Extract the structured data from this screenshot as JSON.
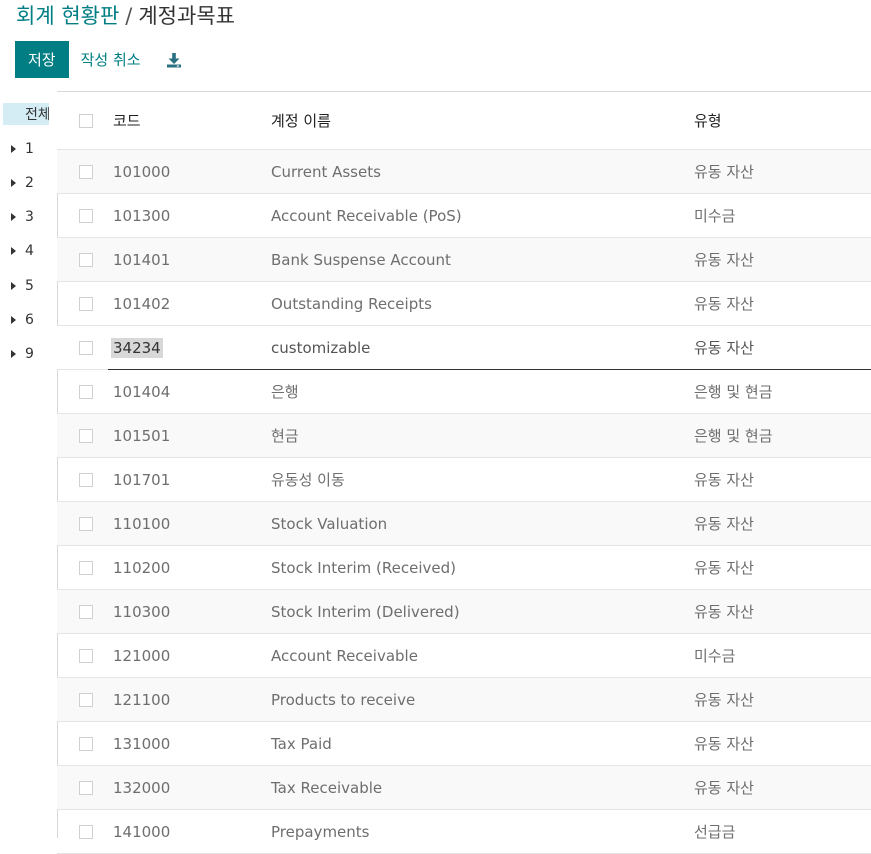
{
  "breadcrumb": {
    "parent": "회계 현황판",
    "separator": "/",
    "current": "계정과목표"
  },
  "toolbar": {
    "save_label": "저장",
    "discard_label": "작성 취소",
    "download_icon": "download-icon"
  },
  "sidebar": {
    "all_label": "전체",
    "groups": [
      "1",
      "2",
      "3",
      "4",
      "5",
      "6",
      "9"
    ]
  },
  "table": {
    "columns": {
      "code": "코드",
      "name": "계정 이름",
      "type": "유형"
    },
    "rows": [
      {
        "code": "101000",
        "name": "Current Assets",
        "type": "유동 자산"
      },
      {
        "code": "101300",
        "name": "Account Receivable (PoS)",
        "type": "미수금"
      },
      {
        "code": "101401",
        "name": "Bank Suspense Account",
        "type": "유동 자산"
      },
      {
        "code": "101402",
        "name": "Outstanding Receipts",
        "type": "유동 자산"
      },
      {
        "code": "34234",
        "name": "customizable",
        "type": "유동 자산",
        "editing": true
      },
      {
        "code": "101404",
        "name": "은행",
        "type": "은행 및 현금"
      },
      {
        "code": "101501",
        "name": "현금",
        "type": "은행 및 현금"
      },
      {
        "code": "101701",
        "name": "유동성 이동",
        "type": "유동 자산"
      },
      {
        "code": "110100",
        "name": "Stock Valuation",
        "type": "유동 자산"
      },
      {
        "code": "110200",
        "name": "Stock Interim (Received)",
        "type": "유동 자산"
      },
      {
        "code": "110300",
        "name": "Stock Interim (Delivered)",
        "type": "유동 자산"
      },
      {
        "code": "121000",
        "name": "Account Receivable",
        "type": "미수금"
      },
      {
        "code": "121100",
        "name": "Products to receive",
        "type": "유동 자산"
      },
      {
        "code": "131000",
        "name": "Tax Paid",
        "type": "유동 자산"
      },
      {
        "code": "132000",
        "name": "Tax Receivable",
        "type": "유동 자산"
      },
      {
        "code": "141000",
        "name": "Prepayments",
        "type": "선급금"
      }
    ]
  },
  "colors": {
    "accent": "#017e84",
    "sidebar_selected": "#d4ecf4"
  }
}
